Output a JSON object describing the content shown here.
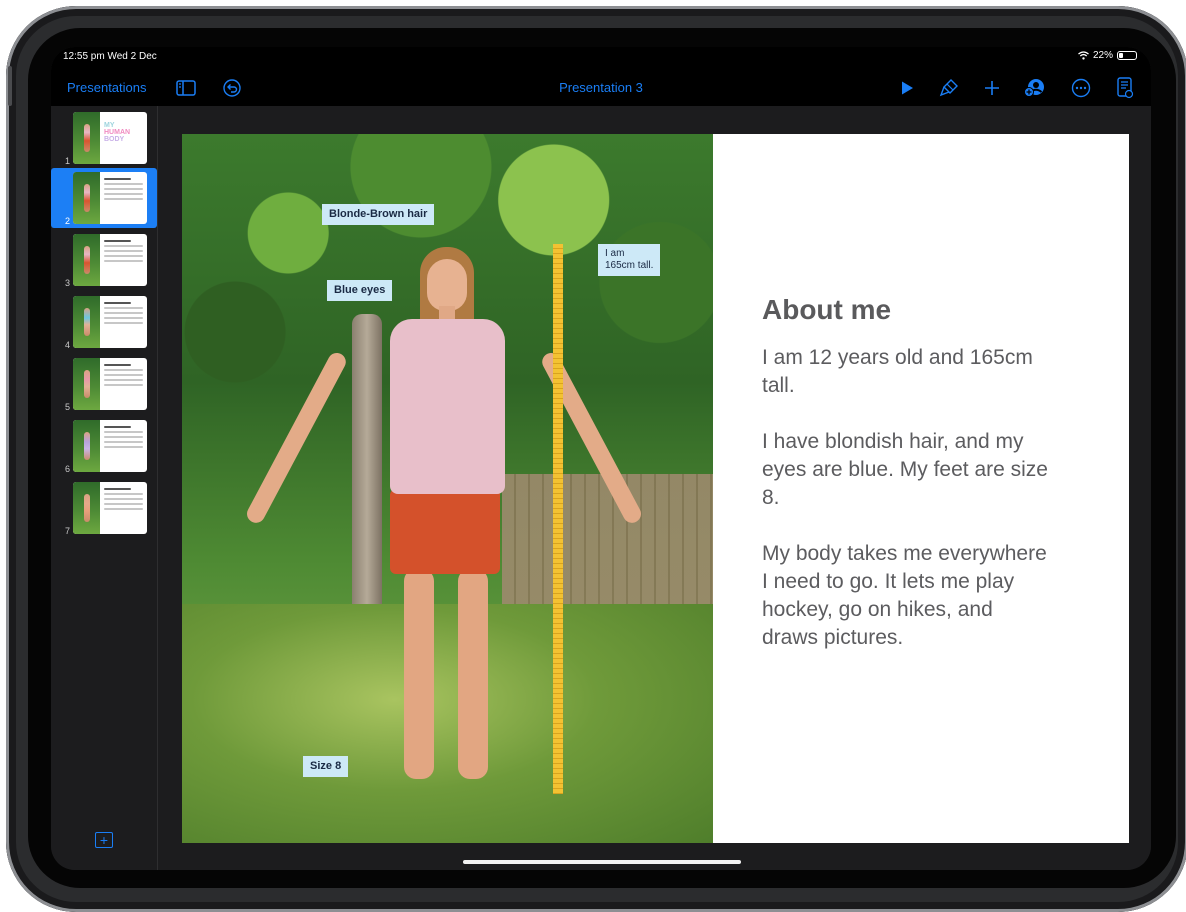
{
  "status_bar": {
    "time_date": "12:55 pm  Wed 2 Dec",
    "wifi_icon": "wifi-icon",
    "battery_percent": "22%",
    "battery_icon": "battery-icon",
    "battery_level": 0.22
  },
  "toolbar": {
    "presentations_label": "Presentations",
    "document_title": "Presentation 3",
    "icons": {
      "sidebar_toggle": "sidebar-toggle-icon",
      "undo": "undo-icon",
      "play": "play-icon",
      "format": "paintbrush-icon",
      "add": "plus-icon",
      "collaborate": "collaborate-icon",
      "more": "ellipsis-circle-icon",
      "presenter_notes": "presenter-notes-icon"
    },
    "accent_color": "#1a7ef5"
  },
  "navigator": {
    "selected_index": 2,
    "slides": [
      {
        "number": "1",
        "title_lines": [
          "MY",
          "HUMAN",
          "BODY"
        ]
      },
      {
        "number": "2"
      },
      {
        "number": "3"
      },
      {
        "number": "4"
      },
      {
        "number": "5"
      },
      {
        "number": "6"
      },
      {
        "number": "7"
      }
    ],
    "add_slide_icon": "add-slide-icon"
  },
  "slide": {
    "callouts": {
      "hair": "Blonde-Brown hair",
      "eyes": "Blue eyes",
      "height_line1": "I am",
      "height_line2": "165cm tall.",
      "feet": "Size 8"
    },
    "heading": "About me",
    "paragraphs": [
      "I am 12 years old and 165cm tall.",
      "I have blondish hair, and my eyes are blue. My feet are size 8.",
      "My body takes me everywhere I need to go. It lets me play hockey, go on hikes, and draws pictures."
    ]
  }
}
